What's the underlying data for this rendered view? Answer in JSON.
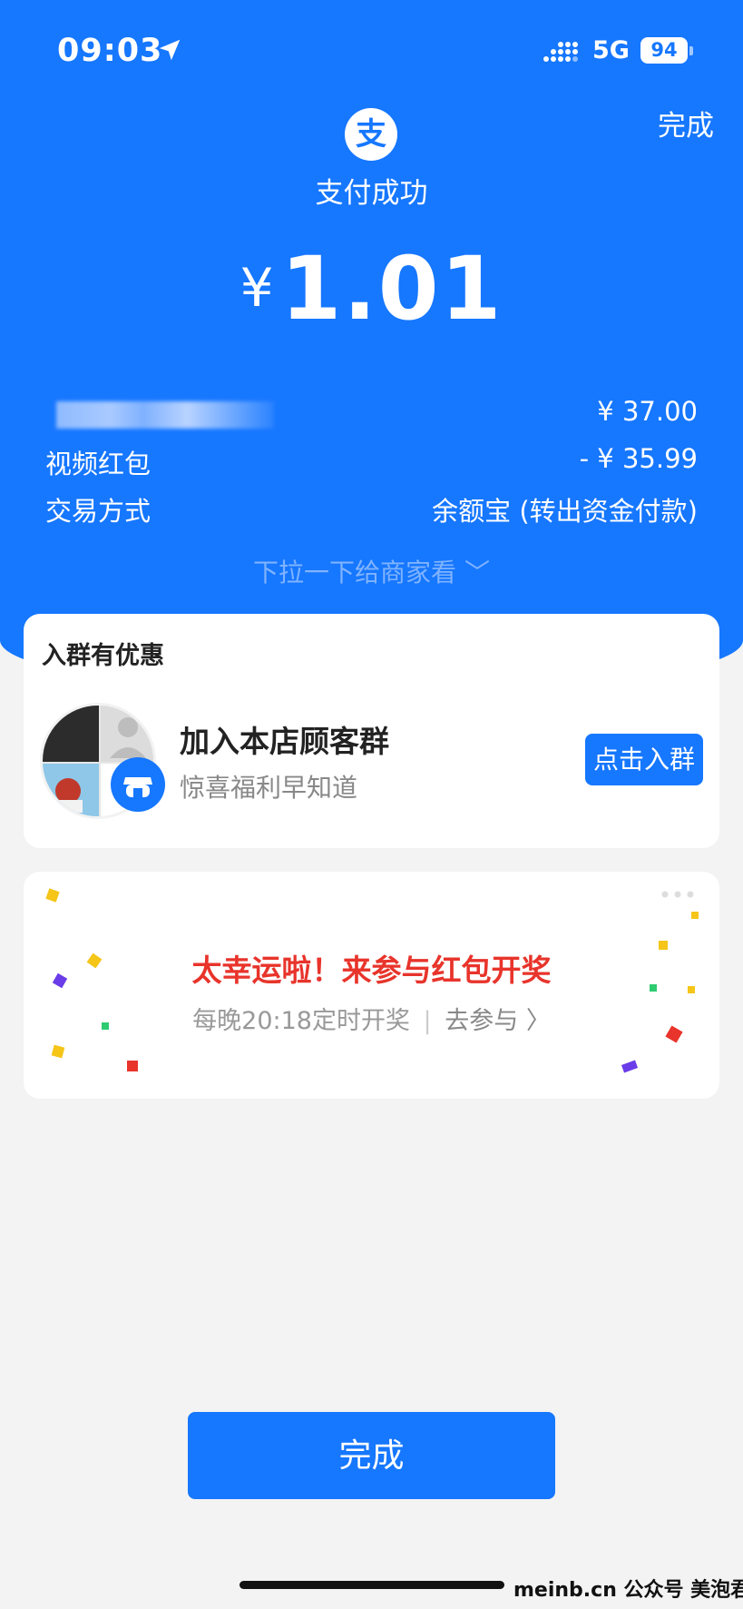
{
  "status_bar": {
    "time": "09:03",
    "network": "5G",
    "battery": "94"
  },
  "header": {
    "done_label": "完成",
    "logo_char": "支",
    "title": "支付成功",
    "currency": "¥",
    "amount": "1.01"
  },
  "details": [
    {
      "label": "",
      "value": "¥ 37.00"
    },
    {
      "label": "视频红包",
      "value": "- ¥ 35.99"
    },
    {
      "label": "交易方式",
      "value": "余额宝 (转出资金付款)"
    }
  ],
  "pull_hint": "下拉一下给商家看 ﹀",
  "group_card": {
    "title": "入群有优惠",
    "name": "加入本店顾客群",
    "subtitle": "惊喜福利早知道",
    "button": "点击入群"
  },
  "lucky_card": {
    "title": "太幸运啦！来参与红包开奖",
    "schedule": "每晚20:18定时开奖",
    "link": "去参与 〉"
  },
  "footer": {
    "done_button": "完成",
    "watermark": "meinb.cn 公众号 美泡君"
  },
  "colors": {
    "brand_blue": "#1677ff",
    "lucky_red": "#e8342b"
  },
  "icons": [
    "location-arrow-icon",
    "signal-icon",
    "battery-icon",
    "alipay-logo-icon",
    "chevron-down-icon",
    "store-icon",
    "more-dots-icon",
    "chevron-right-icon"
  ]
}
